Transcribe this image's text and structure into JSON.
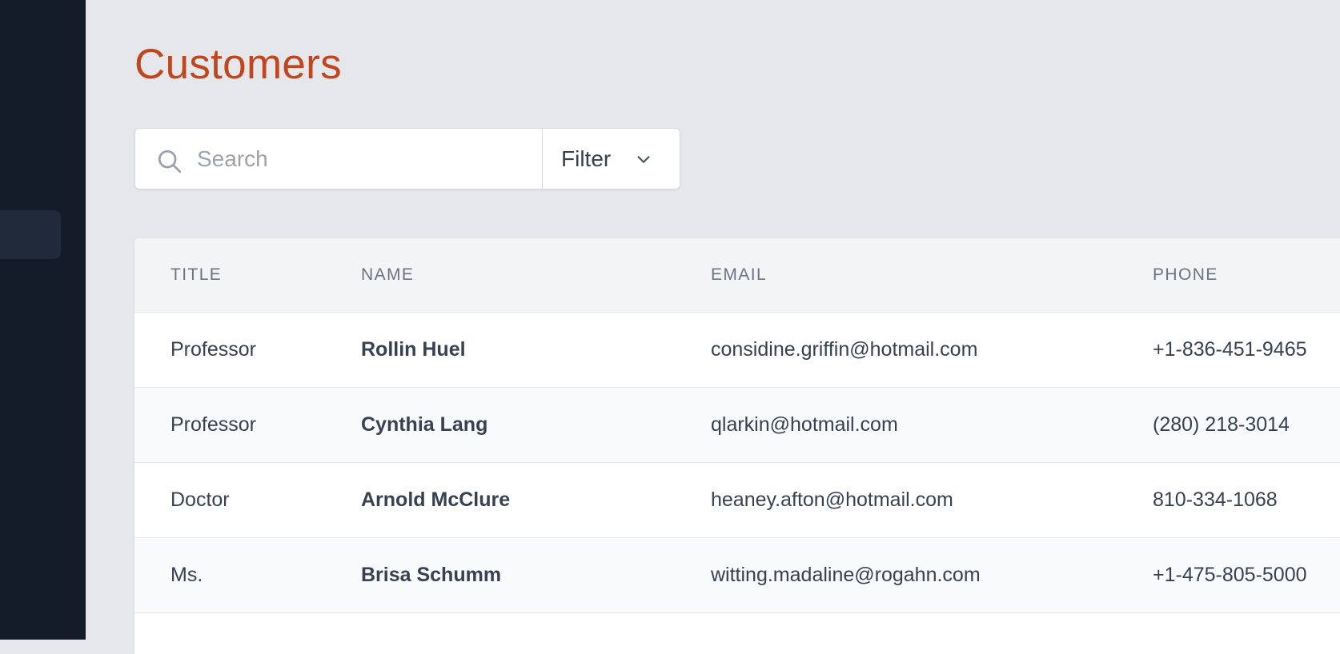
{
  "page": {
    "title": "Customers"
  },
  "search": {
    "placeholder": "Search"
  },
  "filter": {
    "label": "Filter"
  },
  "table": {
    "columns": [
      "TITLE",
      "NAME",
      "EMAIL",
      "PHONE"
    ],
    "rows": [
      {
        "title": "Professor",
        "name": "Rollin Huel",
        "email": "considine.griffin@hotmail.com",
        "phone": "+1-836-451-9465"
      },
      {
        "title": "Professor",
        "name": "Cynthia Lang",
        "email": "qlarkin@hotmail.com",
        "phone": "(280) 218-3014"
      },
      {
        "title": "Doctor",
        "name": "Arnold McClure",
        "email": "heaney.afton@hotmail.com",
        "phone": "810-334-1068"
      },
      {
        "title": "Ms.",
        "name": "Brisa Schumm",
        "email": "witting.madaline@rogahn.com",
        "phone": "+1-475-805-5000"
      }
    ]
  },
  "icons": {
    "search": "search-icon",
    "filter_chevron": "chevron-down-icon"
  },
  "colors": {
    "title": "#c0461f",
    "sidebar": "#141b29",
    "background": "#e6e7eb"
  }
}
